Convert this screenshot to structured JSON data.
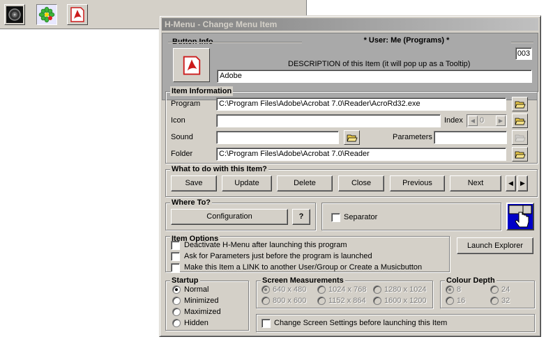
{
  "window": {
    "title": "H-Menu - Change Menu Item"
  },
  "button_info": {
    "section_title": "Button Info",
    "user_heading": "* User: Me (Programs) *",
    "item_number": "003",
    "description_label": "DESCRIPTION of this Item (it will pop up as a Tooltip)",
    "description_value": "Adobe"
  },
  "item_information": {
    "section_title": "Item Information",
    "program_label": "Program",
    "program_value": "C:\\Program Files\\Adobe\\Acrobat 7.0\\Reader\\AcroRd32.exe",
    "icon_label": "Icon",
    "icon_value": "",
    "index_label": "Index",
    "index_value": "0",
    "sound_label": "Sound",
    "sound_value": "",
    "parameters_label": "Parameters",
    "parameters_value": "",
    "folder_label": "Folder",
    "folder_value": "C:\\Program Files\\Adobe\\Acrobat 7.0\\Reader"
  },
  "actions": {
    "section_title": "What to do with this Item?",
    "save": "Save",
    "update": "Update",
    "delete": "Delete",
    "close": "Close",
    "previous": "Previous",
    "next": "Next"
  },
  "where_to": {
    "section_title": "Where To?",
    "configuration": "Configuration",
    "help": "?",
    "separator": "Separator"
  },
  "item_options": {
    "section_title": "Item Options",
    "options": [
      "Deactivate H-Menu after launching this program",
      "Ask for Parameters just before the program is launched",
      "Make this Item a LINK to another User/Group or Create a Musicbutton"
    ],
    "launch_explorer": "Launch Explorer"
  },
  "startup": {
    "section_title": "Startup",
    "options": [
      "Normal",
      "Minimized",
      "Maximized",
      "Hidden"
    ],
    "selected": "Normal"
  },
  "screen": {
    "section_title": "Screen Measurements",
    "options": [
      "640 x 480",
      "1024 x 768",
      "1280 x 1024",
      "800 x 600",
      "1152 x 864",
      "1600 x 1200"
    ],
    "selected": "640 x 480"
  },
  "colour": {
    "section_title": "Colour Depth",
    "options": [
      "8",
      "24",
      "16",
      "32"
    ],
    "selected": "8"
  },
  "change_screen": "Change Screen Settings before launching this Item",
  "colors": {
    "accent_red": "#cc1b1b",
    "blue": "#0000c8",
    "gray_band": "#a9a9a9"
  }
}
